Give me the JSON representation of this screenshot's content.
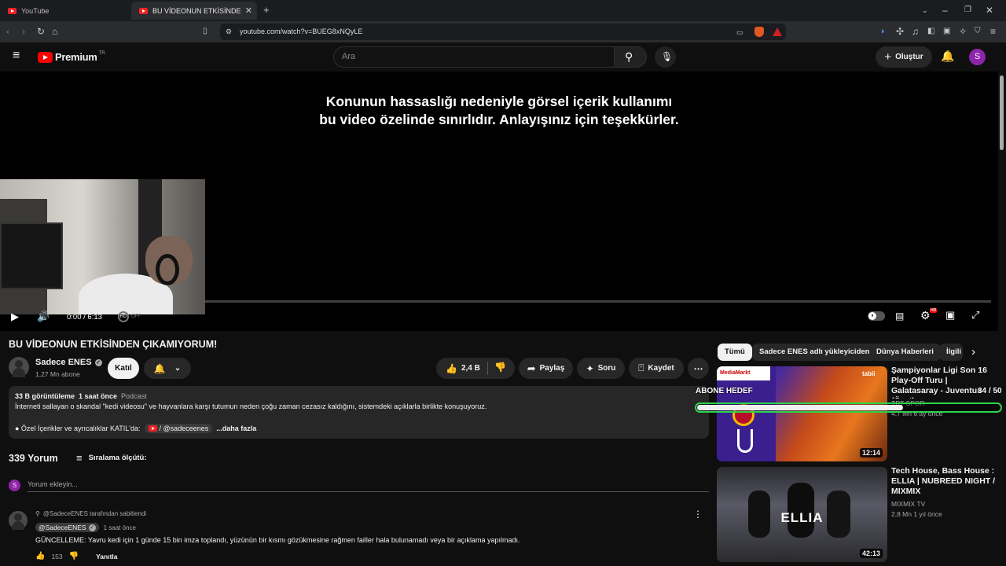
{
  "browser": {
    "tabs": [
      {
        "label": "YouTube"
      },
      {
        "label": "BU VİDEONUN ETKİSİNDEN ÇIKAMIYORUM!"
      }
    ],
    "new_tab": "+",
    "url": "youtube.com/watch?v=BUEG8xNQyLE"
  },
  "header": {
    "logo_text": "Premium",
    "logo_sup": "TR",
    "search_placeholder": "Ara",
    "create_label": "Oluştur",
    "avatar_letter": "S"
  },
  "player": {
    "overlay_line1": "Konunun hassaslığı nedeniyle görsel içerik kullanımı",
    "overlay_line2": "bu video özelinde sınırlıdır. Anlayışınız için teşekkürler.",
    "time": "0:00 / 6:13",
    "ambient_label": "OFF",
    "hd_badge": "HD",
    "progress": 0
  },
  "video": {
    "title": "BU VİDEONUN ETKİSİNDEN ÇIKAMIYORUM!",
    "channel": "Sadece ENES",
    "subscribers": "1,27 Mn abone",
    "join_label": "Katıl",
    "likes": "2,4 B",
    "share_label": "Paylaş",
    "ask_label": "Soru",
    "save_label": "Kaydet"
  },
  "description": {
    "views": "33 B görüntüleme",
    "time": "1 saat önce",
    "tag": "Podcast",
    "text": "İnterneti sallayan o skandal \"kedi videosu\" ve hayvanlara karşı tutumun neden çoğu zaman cezasız kaldığını, sistemdeki açıklarla birlikte konuşuyoruz.",
    "line2": "● Özel İçerikler ve ayrıcalıklar KATIL'da:",
    "link": "/ @sadeceenes",
    "more": "...daha fazla"
  },
  "comments": {
    "count": "339 Yorum",
    "sort_label": "Sıralama ölçütü:",
    "add_placeholder": "Yorum ekleyin...",
    "avatar_letter": "S",
    "pinned": {
      "pinned_by": "@SadeceENES tarafından sabitlendi",
      "author": "@SadeceENES",
      "time": "1 saat önce",
      "text": "GÜNCELLEME: Yavru kedi için 1 günde 15 bin imza toplandı, yüzünün bir kısmı gözükmesine rağmen failler hala bulunamadı veya bir açıklama yapılmadı.",
      "likes": "153",
      "reply": "Yanıtla"
    }
  },
  "chips": [
    {
      "label": "Tümü"
    },
    {
      "label": "Sadece ENES adlı yükleyiciden"
    },
    {
      "label": "Dünya Haberleri"
    },
    {
      "label": "İlgili"
    }
  ],
  "overlay": {
    "sub_label": "ABONE HEDEF",
    "sub_count": "34 / 50",
    "sub_progress": 0.68
  },
  "related": [
    {
      "title": "Şampiyonlar Ligi Son 16 Play-Off Turu | Galatasaray - Juventus (Özet)",
      "channel": "TRT SPOR",
      "meta": "4,7 Mn  6 ay önce",
      "duration": "12:14",
      "badge": "tabii"
    },
    {
      "title": "Tech House, Bass House : ELLIA | NUBREED NIGHT / MIXMIX",
      "channel": "MIXMIX TV",
      "meta": "2,8 Mn  1 yıl önce",
      "duration": "42:13",
      "thumb_text": "ELLIA"
    }
  ],
  "colors": {
    "bg": "#0f0f0f",
    "accent": "#ff0000",
    "avatar": "#8e24aa",
    "overlay_green": "#2bd44a"
  }
}
